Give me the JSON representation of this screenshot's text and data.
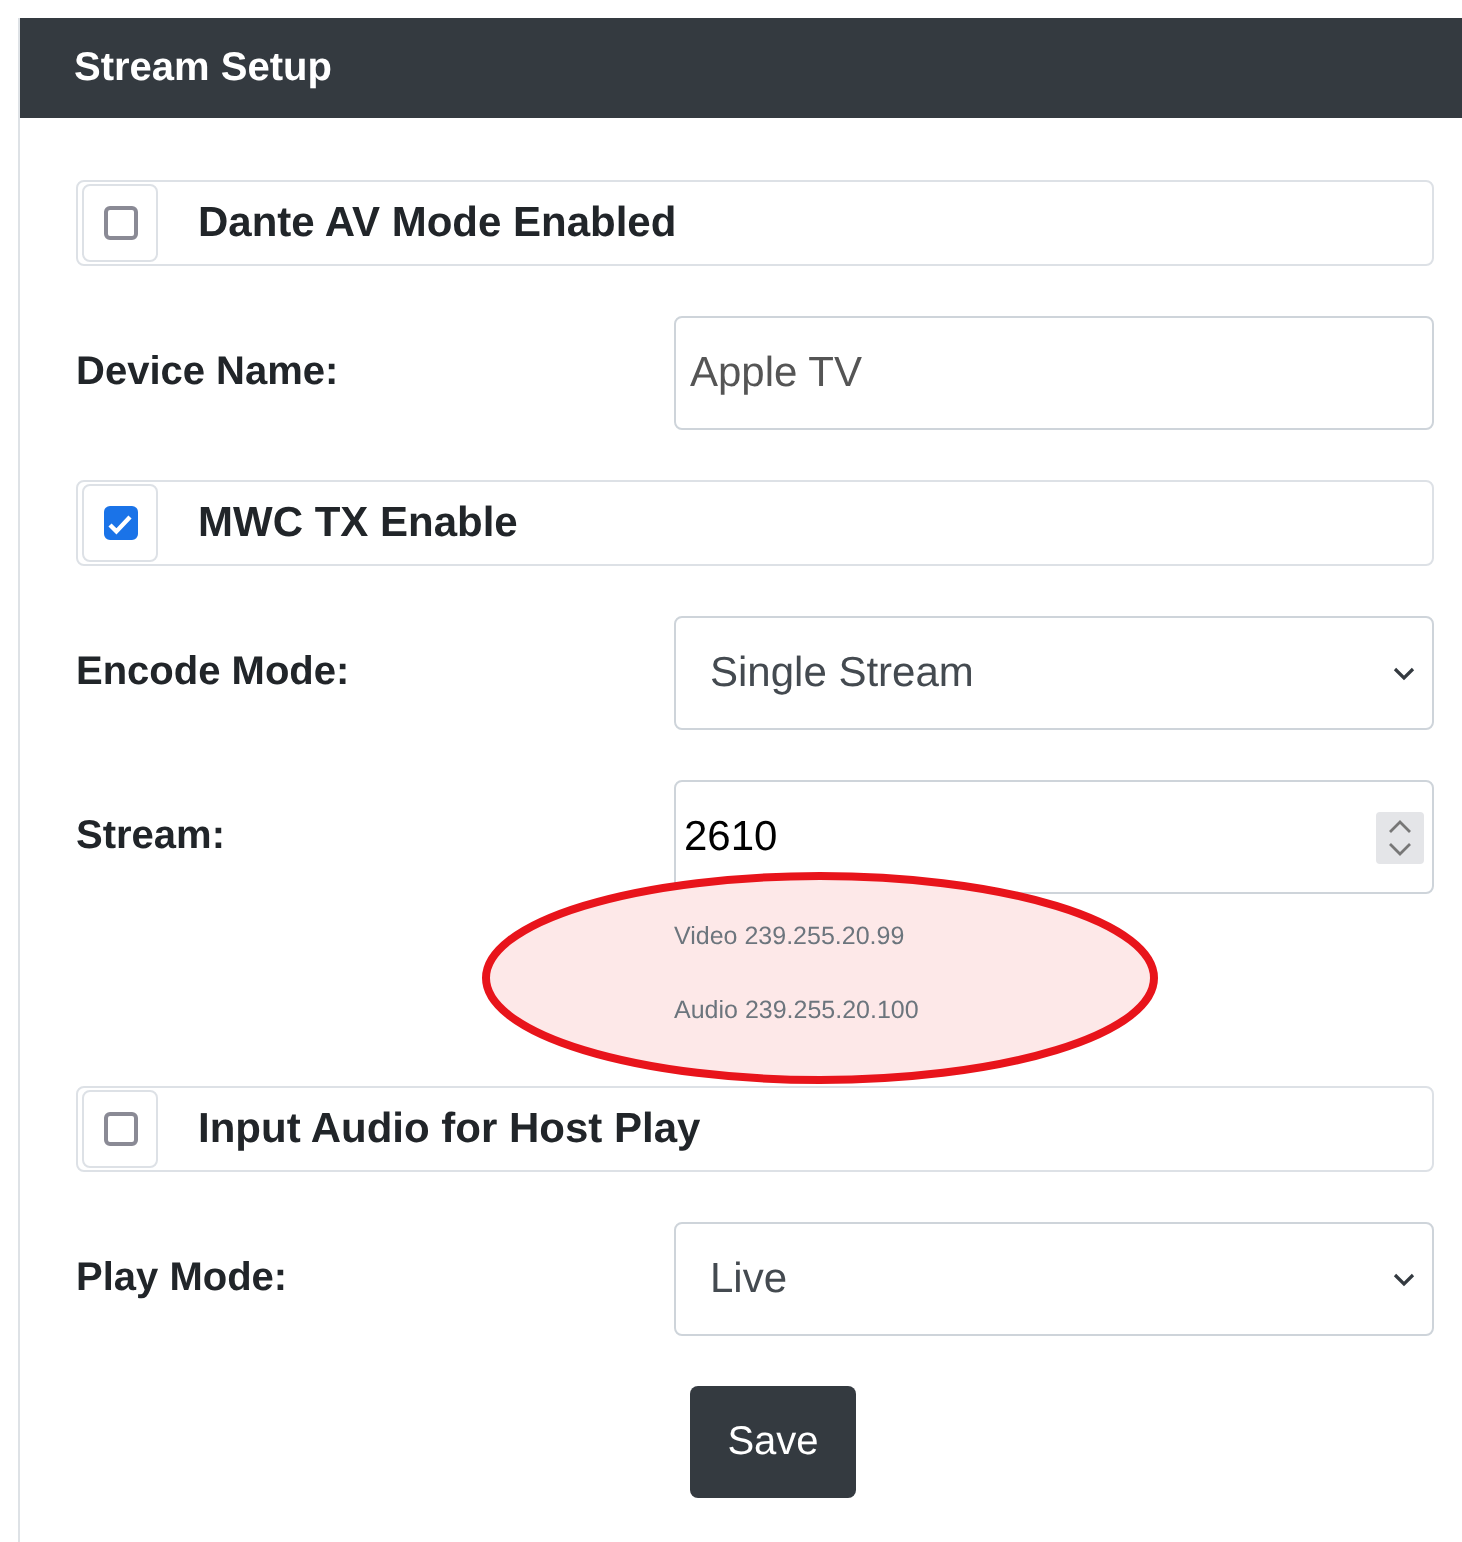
{
  "panel": {
    "title": "Stream Setup"
  },
  "fields": [
    {
      "kind": "checkbox",
      "label": "Dante AV Mode Enabled",
      "checked": false
    },
    {
      "kind": "text",
      "label": "Device Name:",
      "value": "Apple TV"
    },
    {
      "kind": "checkbox",
      "label": "MWC TX Enable",
      "checked": true
    },
    {
      "kind": "select",
      "label": "Encode Mode:",
      "value": "Single Stream"
    },
    {
      "kind": "number",
      "label": "Stream:",
      "value": "2610",
      "notes": [
        "Video 239.255.20.99",
        "Audio 239.255.20.100"
      ],
      "highlighted": true
    },
    {
      "kind": "checkbox",
      "label": "Input Audio for Host Play",
      "checked": false
    },
    {
      "kind": "select",
      "label": "Play Mode:",
      "value": "Live"
    }
  ],
  "save_button": "Save"
}
